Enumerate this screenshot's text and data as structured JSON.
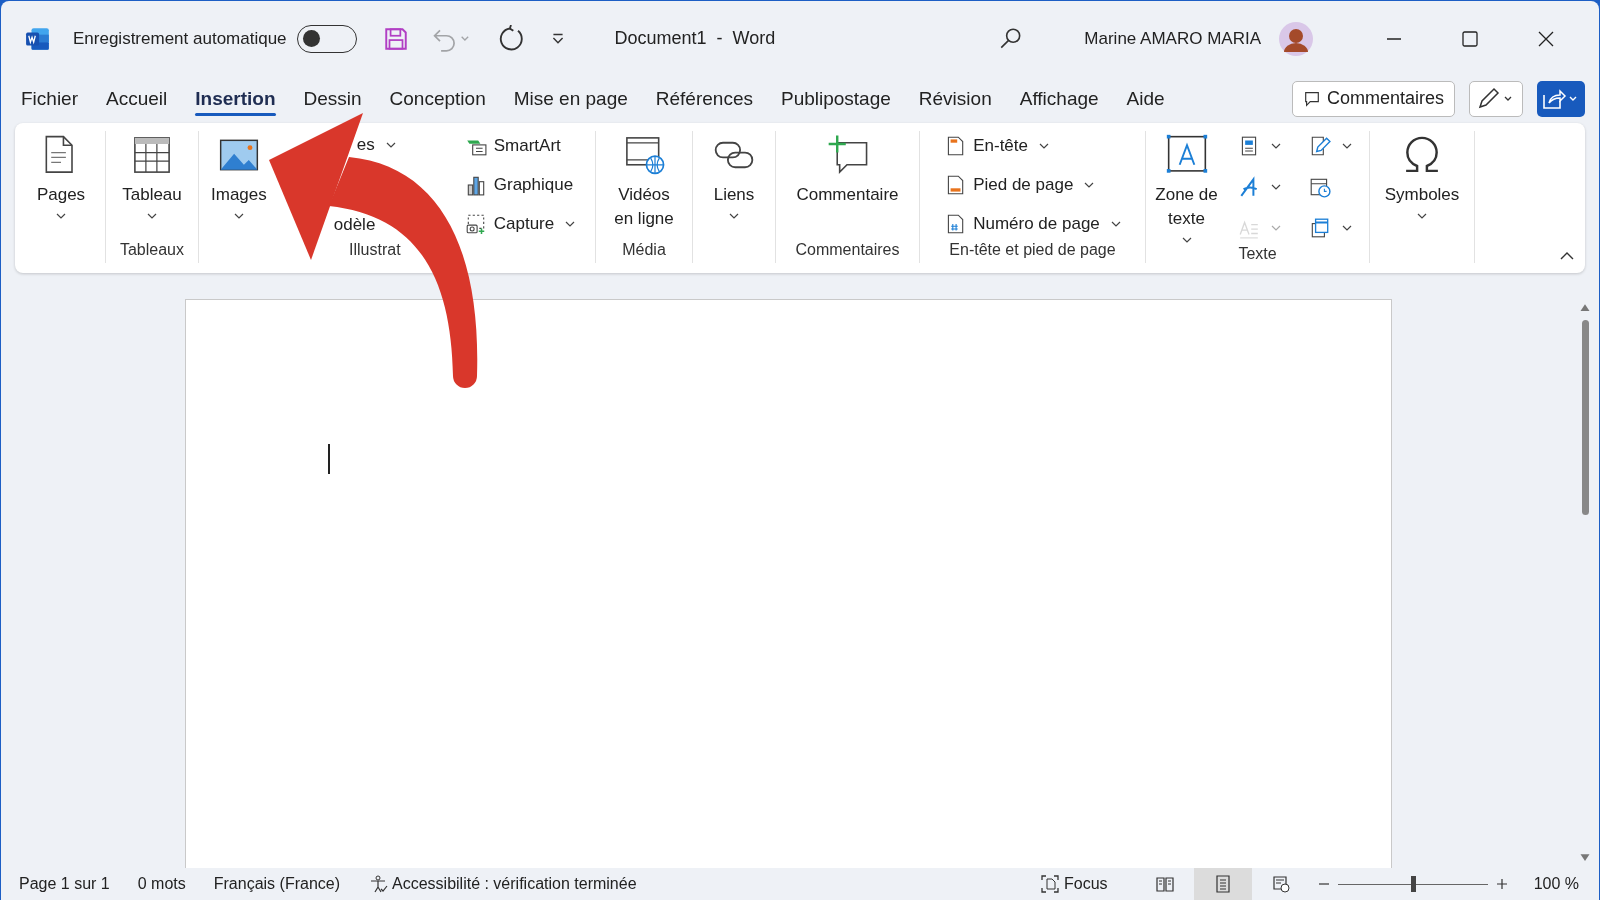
{
  "window": {
    "title": "Document1  -  Word",
    "user": "Marine AMARO MARIA"
  },
  "autosave": {
    "label": "Enregistrement automatique",
    "on": false
  },
  "quick_access": [
    {
      "kind": "save",
      "disabled": false
    },
    {
      "kind": "undo",
      "disabled": true
    },
    {
      "kind": "redo",
      "disabled": false
    },
    {
      "kind": "customize",
      "disabled": false
    }
  ],
  "tabs": [
    {
      "label": "Fichier",
      "selected": false
    },
    {
      "label": "Accueil",
      "selected": false
    },
    {
      "label": "Insertion",
      "selected": true
    },
    {
      "label": "Dessin",
      "selected": false
    },
    {
      "label": "Conception",
      "selected": false
    },
    {
      "label": "Mise en page",
      "selected": false
    },
    {
      "label": "Références",
      "selected": false
    },
    {
      "label": "Publipostage",
      "selected": false
    },
    {
      "label": "Révision",
      "selected": false
    },
    {
      "label": "Affichage",
      "selected": false
    },
    {
      "label": "Aide",
      "selected": false
    }
  ],
  "comments_button": "Commentaires",
  "ribbon_groups": [
    {
      "items": [
        {
          "kind": "large",
          "label": "Pages",
          "dropdown": true,
          "disabled": false
        }
      ]
    },
    {
      "label": "Tableaux",
      "items": [
        {
          "kind": "large",
          "label": "Tableau",
          "dropdown": true,
          "disabled": false
        }
      ]
    },
    {
      "label": "Illustrat",
      "items": [
        {
          "kind": "large",
          "label": "Images",
          "dropdown": true,
          "disabled": false
        },
        {
          "kind": "column",
          "items": [
            {
              "label": "es",
              "dropdown": true,
              "disabled": false
            },
            {
              "label": "odèle",
              "dropdown": false,
              "disabled": false
            }
          ]
        },
        {
          "kind": "column",
          "items": [
            {
              "label": "SmartArt",
              "dropdown": false,
              "disabled": false
            },
            {
              "label": "Graphique",
              "dropdown": false,
              "disabled": false
            },
            {
              "label": "Capture",
              "dropdown": true,
              "disabled": false
            }
          ]
        }
      ]
    },
    {
      "label": "Média",
      "items": [
        {
          "kind": "large",
          "label": "Vidéos en ligne",
          "dropdown": false,
          "disabled": false
        }
      ]
    },
    {
      "items": [
        {
          "kind": "large",
          "label": "Liens",
          "dropdown": true,
          "disabled": false
        }
      ]
    },
    {
      "label": "Commentaires",
      "items": [
        {
          "kind": "large",
          "label": "Commentaire",
          "dropdown": false,
          "disabled": false
        }
      ]
    },
    {
      "label": "En-tête et pied de page",
      "items": [
        {
          "kind": "column",
          "items": [
            {
              "label": "En-tête",
              "dropdown": true,
              "disabled": false
            },
            {
              "label": "Pied de page",
              "dropdown": true,
              "disabled": false
            },
            {
              "label": "Numéro de page",
              "dropdown": true,
              "disabled": false
            }
          ]
        }
      ]
    },
    {
      "label": "Texte",
      "items": [
        {
          "kind": "large",
          "label": "Zone de texte",
          "dropdown": true,
          "disabled": false
        },
        {
          "kind": "column",
          "items": [
            {
              "dropdown": true,
              "disabled": false
            },
            {
              "dropdown": true,
              "disabled": false
            },
            {
              "dropdown": true,
              "disabled": true
            }
          ]
        },
        {
          "kind": "column",
          "items": [
            {
              "dropdown": true,
              "disabled": false
            },
            {
              "dropdown": false,
              "disabled": false
            },
            {
              "dropdown": true,
              "disabled": false
            }
          ]
        }
      ]
    },
    {
      "items": [
        {
          "kind": "large",
          "label": "Symboles",
          "dropdown": true,
          "disabled": false
        }
      ]
    }
  ],
  "status_bar": {
    "page": "Page 1 sur 1",
    "words": "0 mots",
    "language": "Français (France)",
    "accessibility": "Accessibilité : vérification terminée",
    "focus": "Focus",
    "views": [
      {
        "selected": false
      },
      {
        "selected": true
      },
      {
        "selected": false
      }
    ],
    "zoom": {
      "level": 0.5
    },
    "zoom_reading": "100 %"
  }
}
